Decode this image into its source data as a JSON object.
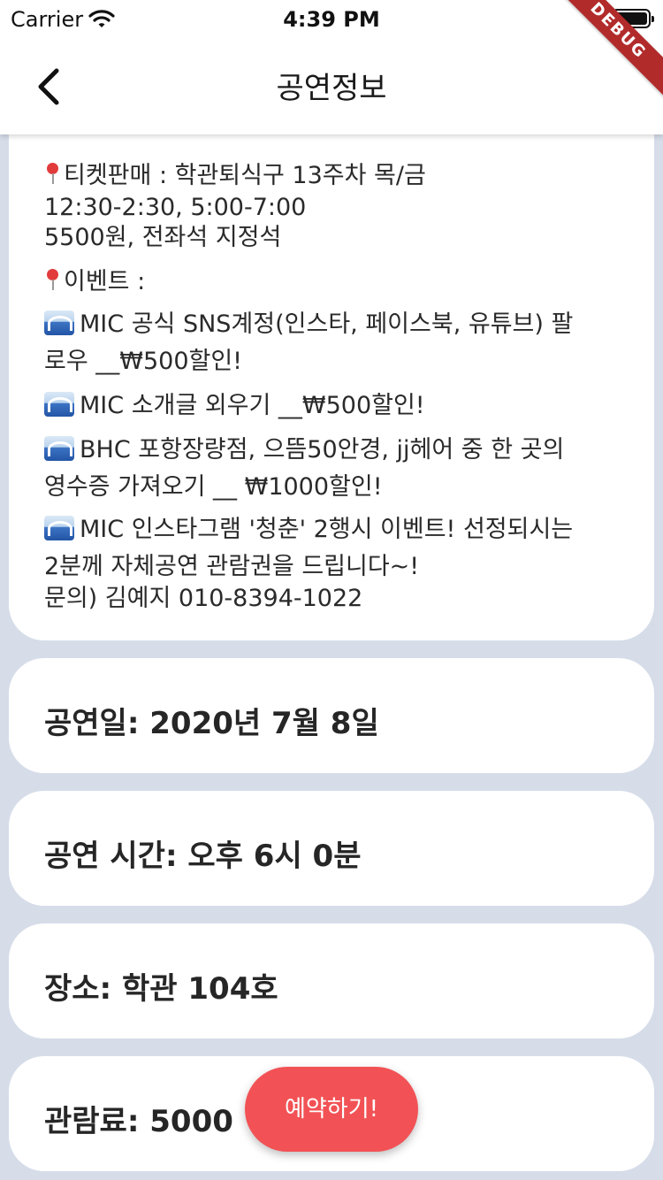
{
  "status_bar": {
    "carrier": "Carrier",
    "time": "4:39 PM"
  },
  "app_bar": {
    "title": "공연정보",
    "debug_banner": "DEBUG"
  },
  "description": {
    "lines": [
      "티켓판매 : 학관퇴식구 13주차 목/금",
      "12:30-2:30, 5:00-7:00",
      " 5500원, 전좌석 지정석",
      "이벤트 :",
      "MIC 공식 SNS계정(인스타, 페이스북, 유튜브) 팔",
      "로우 __₩500할인!",
      "MIC 소개글 외우기 __₩500할인!",
      "BHC 포항장량점, 으뜸50안경, jj헤어 중 한 곳의",
      "영수증  가져오기 __ ₩1000할인!",
      "MIC 인스타그램 '청춘' 2행시 이벤트! 선정되시는",
      "2분께 자체공연 관람권을 드립니다~!",
      "문의) 김예지 010-8394-1022"
    ]
  },
  "info": {
    "date": "공연일: 2020년 7월 8일",
    "time": "공연 시간: 오후 6시 0분",
    "place": "장소: 학관 104호",
    "fee": "관람료: 5000"
  },
  "fab_label": "예약하기!",
  "colors": {
    "background": "#d6dde9",
    "fab": "#f25255",
    "debug": "#b22b2b"
  }
}
